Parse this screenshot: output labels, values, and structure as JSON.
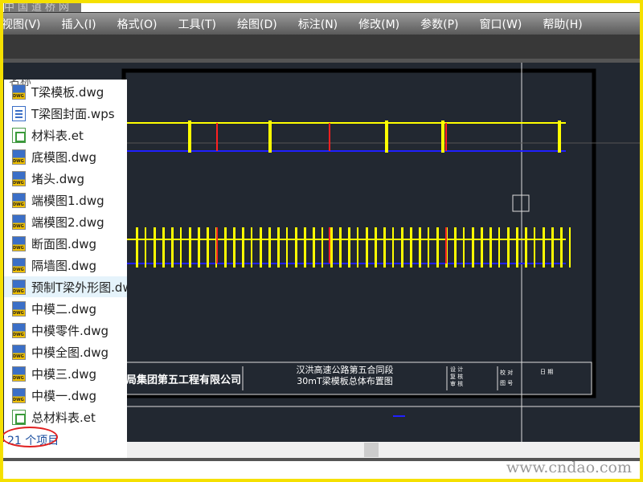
{
  "watermark": "中国道桥网",
  "menu": [
    "视图(V)",
    "插入(I)",
    "格式(O)",
    "工具(T)",
    "绘图(D)",
    "标注(N)",
    "修改(M)",
    "参数(P)",
    "窗口(W)",
    "帮助(H)"
  ],
  "panel": {
    "column_header": "名称",
    "files": [
      {
        "name": "T梁模板.dwg",
        "type": "dwg"
      },
      {
        "name": "T梁图封面.wps",
        "type": "wps"
      },
      {
        "name": "材料表.et",
        "type": "et"
      },
      {
        "name": "底模图.dwg",
        "type": "dwg"
      },
      {
        "name": "堵头.dwg",
        "type": "dwg"
      },
      {
        "name": "端模图1.dwg",
        "type": "dwg"
      },
      {
        "name": "端模图2.dwg",
        "type": "dwg"
      },
      {
        "name": "断面图.dwg",
        "type": "dwg"
      },
      {
        "name": "隔墙图.dwg",
        "type": "dwg"
      },
      {
        "name": "预制T梁外形图.dwg",
        "type": "dwg",
        "selected": true
      },
      {
        "name": "中模二.dwg",
        "type": "dwg"
      },
      {
        "name": "中模零件.dwg",
        "type": "dwg"
      },
      {
        "name": "中模全图.dwg",
        "type": "dwg"
      },
      {
        "name": "中模三.dwg",
        "type": "dwg"
      },
      {
        "name": "中模一.dwg",
        "type": "dwg"
      },
      {
        "name": "总材料表.et",
        "type": "et"
      }
    ],
    "status": "21 个项目"
  },
  "drawing": {
    "company": "局集团第五工程有限公司",
    "project_line1": "汉洪高速公路第五合同段",
    "project_line2": "30mT梁模板总体布置图",
    "cells": [
      "设 计",
      "复 核",
      "审 核",
      "校 对",
      "图 号",
      "日 期"
    ]
  },
  "site": "www.cndao.com",
  "colors": {
    "canvas": "#222831",
    "border": "#f5e000",
    "cad_yellow": "#ffff00",
    "cad_blue": "#2020ff",
    "cad_red": "#ff2020"
  }
}
